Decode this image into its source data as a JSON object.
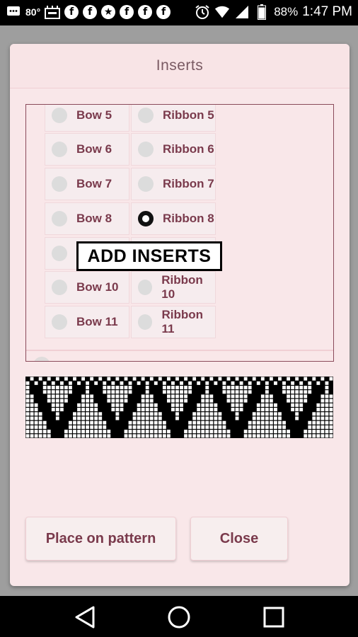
{
  "status_bar": {
    "temperature": "80°",
    "battery_percent": "88%",
    "time": "1:47 PM",
    "notification_icons": [
      "message-icon",
      "temperature-text",
      "calendar-icon",
      "facebook-icon",
      "facebook-icon",
      "star-icon",
      "facebook-icon",
      "facebook-icon",
      "facebook-icon"
    ],
    "right_icons": [
      "alarm-icon",
      "wifi-icon",
      "signal-icon",
      "battery-icon"
    ]
  },
  "dialog": {
    "title": "Inserts",
    "items": [
      {
        "left": "Bow 5",
        "right": "Ribbon 5",
        "left_checked": false,
        "right_checked": false
      },
      {
        "left": "Bow 6",
        "right": "Ribbon 6",
        "left_checked": false,
        "right_checked": false
      },
      {
        "left": "Bow 7",
        "right": "Ribbon 7",
        "left_checked": false,
        "right_checked": false
      },
      {
        "left": "Bow 8",
        "right": "Ribbon 8",
        "left_checked": false,
        "right_checked": true
      },
      {
        "left": "",
        "right": "",
        "left_checked": false,
        "right_checked": false
      },
      {
        "left": "Bow 10",
        "right": "Ribbon 10",
        "left_checked": false,
        "right_checked": false
      },
      {
        "left": "Bow 11",
        "right": "Ribbon 11",
        "left_checked": false,
        "right_checked": false
      }
    ],
    "overlay_label": "ADD INSERTS",
    "buttons": {
      "place": "Place on pattern",
      "close": "Close"
    }
  },
  "nav_bar": {
    "icons": [
      "back-icon",
      "home-icon",
      "recents-icon"
    ]
  },
  "colors": {
    "dialog_bg": "#f9e7e9",
    "label_color": "#7a3a4c",
    "frame_border": "#8a4a5a"
  }
}
